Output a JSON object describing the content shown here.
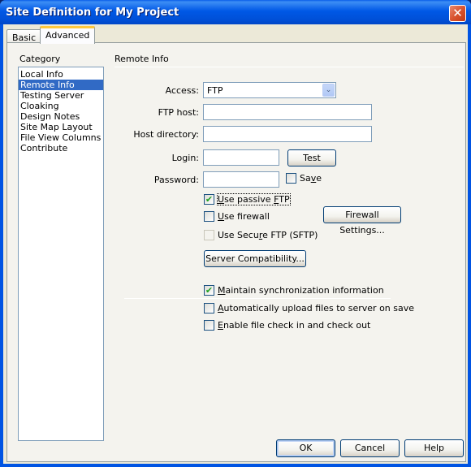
{
  "window": {
    "title": "Site Definition for My Project",
    "close_icon": "close-x-icon"
  },
  "tabs": [
    {
      "label": "Basic",
      "active": false
    },
    {
      "label": "Advanced",
      "active": true
    }
  ],
  "category": {
    "label": "Category",
    "items": [
      {
        "label": "Local Info",
        "selected": false
      },
      {
        "label": "Remote Info",
        "selected": true
      },
      {
        "label": "Testing Server",
        "selected": false
      },
      {
        "label": "Cloaking",
        "selected": false
      },
      {
        "label": "Design Notes",
        "selected": false
      },
      {
        "label": "Site Map Layout",
        "selected": false
      },
      {
        "label": "File View Columns",
        "selected": false
      },
      {
        "label": "Contribute",
        "selected": false
      }
    ]
  },
  "remote_info": {
    "title": "Remote Info",
    "access": {
      "label": "Access:",
      "value": "FTP"
    },
    "ftp_host": {
      "label": "FTP host:",
      "value": ""
    },
    "host_directory": {
      "label": "Host directory:",
      "value": ""
    },
    "login": {
      "label": "Login:",
      "value": ""
    },
    "password": {
      "label": "Password:",
      "value": ""
    },
    "test_button": "Test",
    "save": {
      "pre": "Sa",
      "accel": "v",
      "post": "e",
      "checked": false
    },
    "passive_ftp": {
      "pre": "",
      "accel": "U",
      "mid": "se passive ",
      "accel2": "F",
      "post": "TP",
      "checked": true
    },
    "use_firewall": {
      "accel": "U",
      "post": "se firewall",
      "checked": false
    },
    "secure_ftp": {
      "pre": "Use Secu",
      "accel": "r",
      "post": "e FTP (SFTP)",
      "checked": false,
      "disabled": true
    },
    "firewall_settings_button": "Firewall Settings...",
    "server_compat_button": "Server Compatibility...",
    "maintain_sync": {
      "accel": "M",
      "post": "aintain synchronization information",
      "checked": true
    },
    "auto_upload": {
      "accel": "A",
      "post": "utomatically upload files to server on save",
      "checked": false
    },
    "check_in_out": {
      "accel": "E",
      "post": "nable file check in and check out",
      "checked": false
    }
  },
  "footer": {
    "ok": "OK",
    "cancel": "Cancel",
    "help": "Help"
  },
  "icons": {
    "check_mark": "✔",
    "dropdown_arrow": "⌄",
    "close": "✕"
  }
}
